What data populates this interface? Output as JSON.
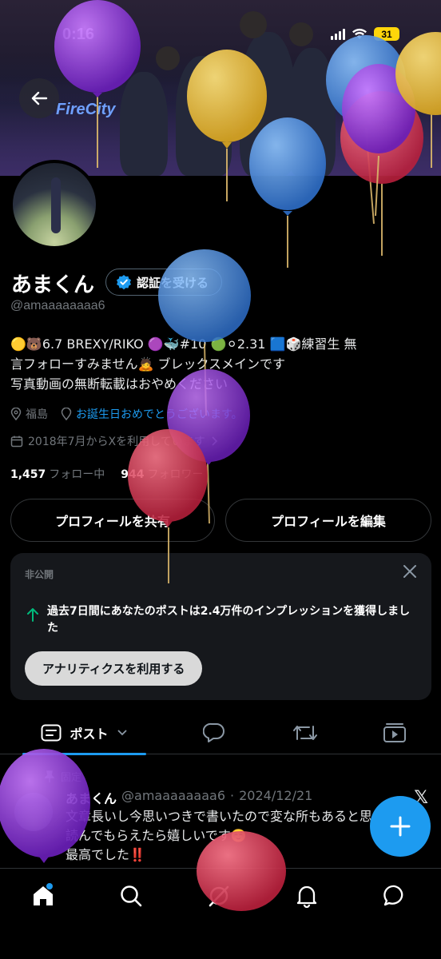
{
  "status_bar": {
    "time": "0:16",
    "battery": "31"
  },
  "banner": {
    "text": "FireCity"
  },
  "profile": {
    "name": "あまくん",
    "verify_label": "認証を受ける",
    "handle": "@amaaaaaaaa6",
    "bio_line1": "🟡🐻6.7 BREXY/RIKO 🟣🐳#10 🟢⚪2.31 🟦🎲練習生 無",
    "bio_line2": "言フォローすみません🙇 ブレックスメインです",
    "bio_line3": "写真動画の無断転載はおやめください",
    "location": "福島",
    "birthday_link": "お誕生日おめでとうございます。",
    "joined": "2018年7月からXを利用しています",
    "following_count": "1,457",
    "following_label": "フォロー中",
    "followers_count": "944",
    "followers_label": "フォロワー"
  },
  "actions": {
    "share_label": "プロフィールを共有",
    "edit_label": "プロフィールを編集"
  },
  "card": {
    "private_label": "非公開",
    "message": "過去7日間にあなたのポストは2.4万件のインプレッションを獲得しました",
    "analytics_label": "アナリティクスを利用する"
  },
  "tabs": {
    "posts_label": "ポスト"
  },
  "post": {
    "pinned_label": "固定",
    "author": "あまくん",
    "handle": "@amaaaaaaaa6",
    "date": "2024/12/21",
    "text": "文章長いし今思いつきで書いたので変な所もあると思いますが読んでもらえたら嬉しいです☺️",
    "text2": "最高でした‼️"
  },
  "colors": {
    "accent": "#1d9bf0",
    "balloon_purple": "#8a2be2",
    "balloon_yellow": "#f2c53d",
    "balloon_blue": "#4a90e2",
    "balloon_red": "#d9304f"
  }
}
